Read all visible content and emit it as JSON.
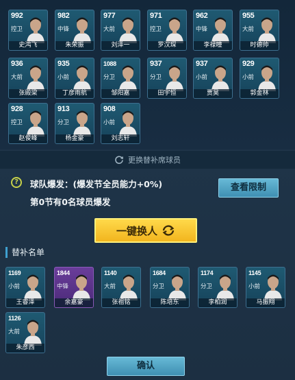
{
  "starters": [
    {
      "rating": "992",
      "pos": "控卫",
      "name": "史鸿飞"
    },
    {
      "rating": "982",
      "pos": "中锋",
      "name": "朱荣振"
    },
    {
      "rating": "977",
      "pos": "大前",
      "name": "刘泽一"
    },
    {
      "rating": "971",
      "pos": "控卫",
      "name": "罗汉琛"
    },
    {
      "rating": "962",
      "pos": "中锋",
      "name": "李禄瞳"
    },
    {
      "rating": "955",
      "pos": "大前",
      "name": "时德帅"
    },
    {
      "rating": "936",
      "pos": "大前",
      "name": "张殿梁"
    },
    {
      "rating": "935",
      "pos": "小前",
      "name": "丁彦雨航"
    },
    {
      "rating": "1088",
      "pos": "分卫",
      "name": "邹阳嘉"
    },
    {
      "rating": "937",
      "pos": "分卫",
      "name": "田宇恒"
    },
    {
      "rating": "937",
      "pos": "小前",
      "name": "贾昊"
    },
    {
      "rating": "929",
      "pos": "小前",
      "name": "郭金林"
    },
    {
      "rating": "928",
      "pos": "控卫",
      "name": "赵俊峰"
    },
    {
      "rating": "913",
      "pos": "分卫",
      "name": "杨金豪"
    },
    {
      "rating": "908",
      "pos": "小前",
      "name": "刘志轩"
    }
  ],
  "swap_bar": {
    "label": "更换替补席球员"
  },
  "burst": {
    "line1": "球队爆发：(爆发节全员能力+0%)",
    "line2": "第0节有0名球员爆发"
  },
  "view_limit_label": "查看限制",
  "onekey_label": "一键换人",
  "bench_title": "替补名单",
  "bench": [
    {
      "rating": "1169",
      "pos": "小前",
      "name": "王睿泽",
      "tier": "teal"
    },
    {
      "rating": "1844",
      "pos": "中锋",
      "name": "余嘉豪",
      "tier": "purple"
    },
    {
      "rating": "1140",
      "pos": "大前",
      "name": "张祖铭",
      "tier": "teal"
    },
    {
      "rating": "1684",
      "pos": "分卫",
      "name": "陈培东",
      "tier": "teal"
    },
    {
      "rating": "1174",
      "pos": "分卫",
      "name": "李柏润",
      "tier": "teal"
    },
    {
      "rating": "1145",
      "pos": "小前",
      "name": "马振翔",
      "tier": "teal"
    },
    {
      "rating": "1126",
      "pos": "大前",
      "name": "朱彦西",
      "tier": "teal"
    }
  ],
  "confirm_label": "确认",
  "colors": {
    "accent_yellow": "#f2b51e",
    "accent_blue": "#3f8fb2",
    "card_teal": "#1f5a72",
    "card_purple": "#6a3d9a"
  }
}
